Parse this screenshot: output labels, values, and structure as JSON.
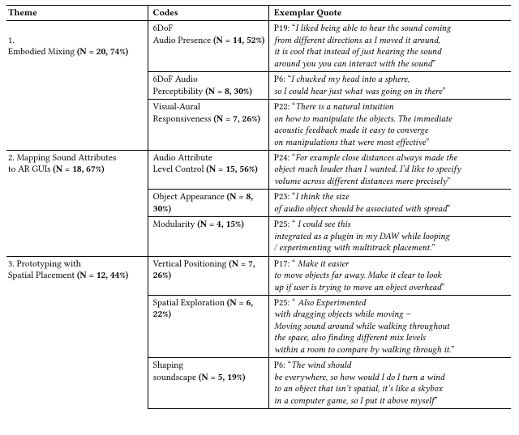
{
  "headers": {
    "theme": "Theme",
    "codes": "Codes",
    "quote": "Exemplar Quote"
  },
  "theme1": {
    "num": "1.",
    "label": "Embodied Mixing ",
    "stat": "(N = 20, 74%)",
    "c1l1": "6DoF",
    "c1l2a": "Audio Presence ",
    "c1l2b": "(N = 14, 52%)",
    "q1p": "P19: “",
    "q1a": "I liked being able to hear the sound coming",
    "q1b": "from different directions as I moved it around,",
    "q1c": "it is cool that instead of just hearing the sound",
    "q1d": "around you you can interact with the sound",
    "q1end": "”",
    "c2l1": "6DoF Audio",
    "c2l2a": "Perceptibility ",
    "c2l2b": "(N = 8, 30%)",
    "q2p": "P6: “",
    "q2a": "I chucked my head into a sphere,",
    "q2b": "so I could hear just what was going on in there",
    "q2end": "”",
    "c3l1": "Visual-Aural",
    "c3l2a": "Responsiveness ",
    "c3l2b": "(N = 7, 26%)",
    "q3p": "P22: “",
    "q3a": "There is a natural intuition",
    "q3b": "on how to manipulate the objects. The immediate",
    "q3c": "acoustic feedback made it easy to converge",
    "q3d": "on manipulations that were most effective",
    "q3end": "”"
  },
  "theme2": {
    "label1": "2. Mapping Sound Attributes",
    "label2a": "to AR GUIs ",
    "label2b": "(N = 18, 67%)",
    "c1l1": "Audio Attribute",
    "c1l2a": "Level Control ",
    "c1l2b": "(N = 15, 56%)",
    "q1p": "P24: “",
    "q1a": "For example close distances always made the",
    "q1b": "object much louder than I wanted. I’d like to specify",
    "q1c": "volume across different distances more precisely",
    "q1end": "”",
    "c2a": "Object Appearance ",
    "c2b": "(N = 8, 30%)",
    "q2p": "P23: “",
    "q2a": "I think the size",
    "q2b": "of audio object should be associated with spread",
    "q2end": "”",
    "c3a": "Modularity ",
    "c3b": "(N = 4, 15%)",
    "q3p": "P25: “",
    "q3a": " I could see this",
    "q3b": "integrated as a plugin in my DAW while looping",
    "q3c": "/ experimenting with multitrack placement.",
    "q3end": "”"
  },
  "theme3": {
    "label1": "3. Prototyping with",
    "label2a": "Spatial Placement ",
    "label2b": "(N = 12, 44%)",
    "c1a": "Vertical Positioning ",
    "c1b": "(N = 7, 26%)",
    "q1p": "P17: “",
    "q1a": " Make it easier",
    "q1b": "to move objects far away. Make it clear to look",
    "q1c": "up if user is trying to move an object overhead",
    "q1end": "”",
    "c2a": "Spatial Exploration ",
    "c2b": "(N = 6, 22%)",
    "q2p": "P25: “",
    "q2a": " Also Experimented",
    "q2b": "with dragging objects while moving –",
    "q2c": "Moving sound around while walking throughout",
    "q2d": "the space, also finding different mix levels",
    "q2e": "within a room to compare by walking through it.",
    "q2end": "”",
    "c3l1": "Shaping",
    "c3l2a": "soundscape ",
    "c3l2b": "(N = 5, 19%)",
    "q3p": "P6: “",
    "q3a": "The wind should",
    "q3b": "be everywhere, so how would I do I turn a wind",
    "q3c": "to an object that isn’t spatial, it’s like a skybox",
    "q3d": "in a computer game, so I put it above myself",
    "q3end": "”"
  }
}
